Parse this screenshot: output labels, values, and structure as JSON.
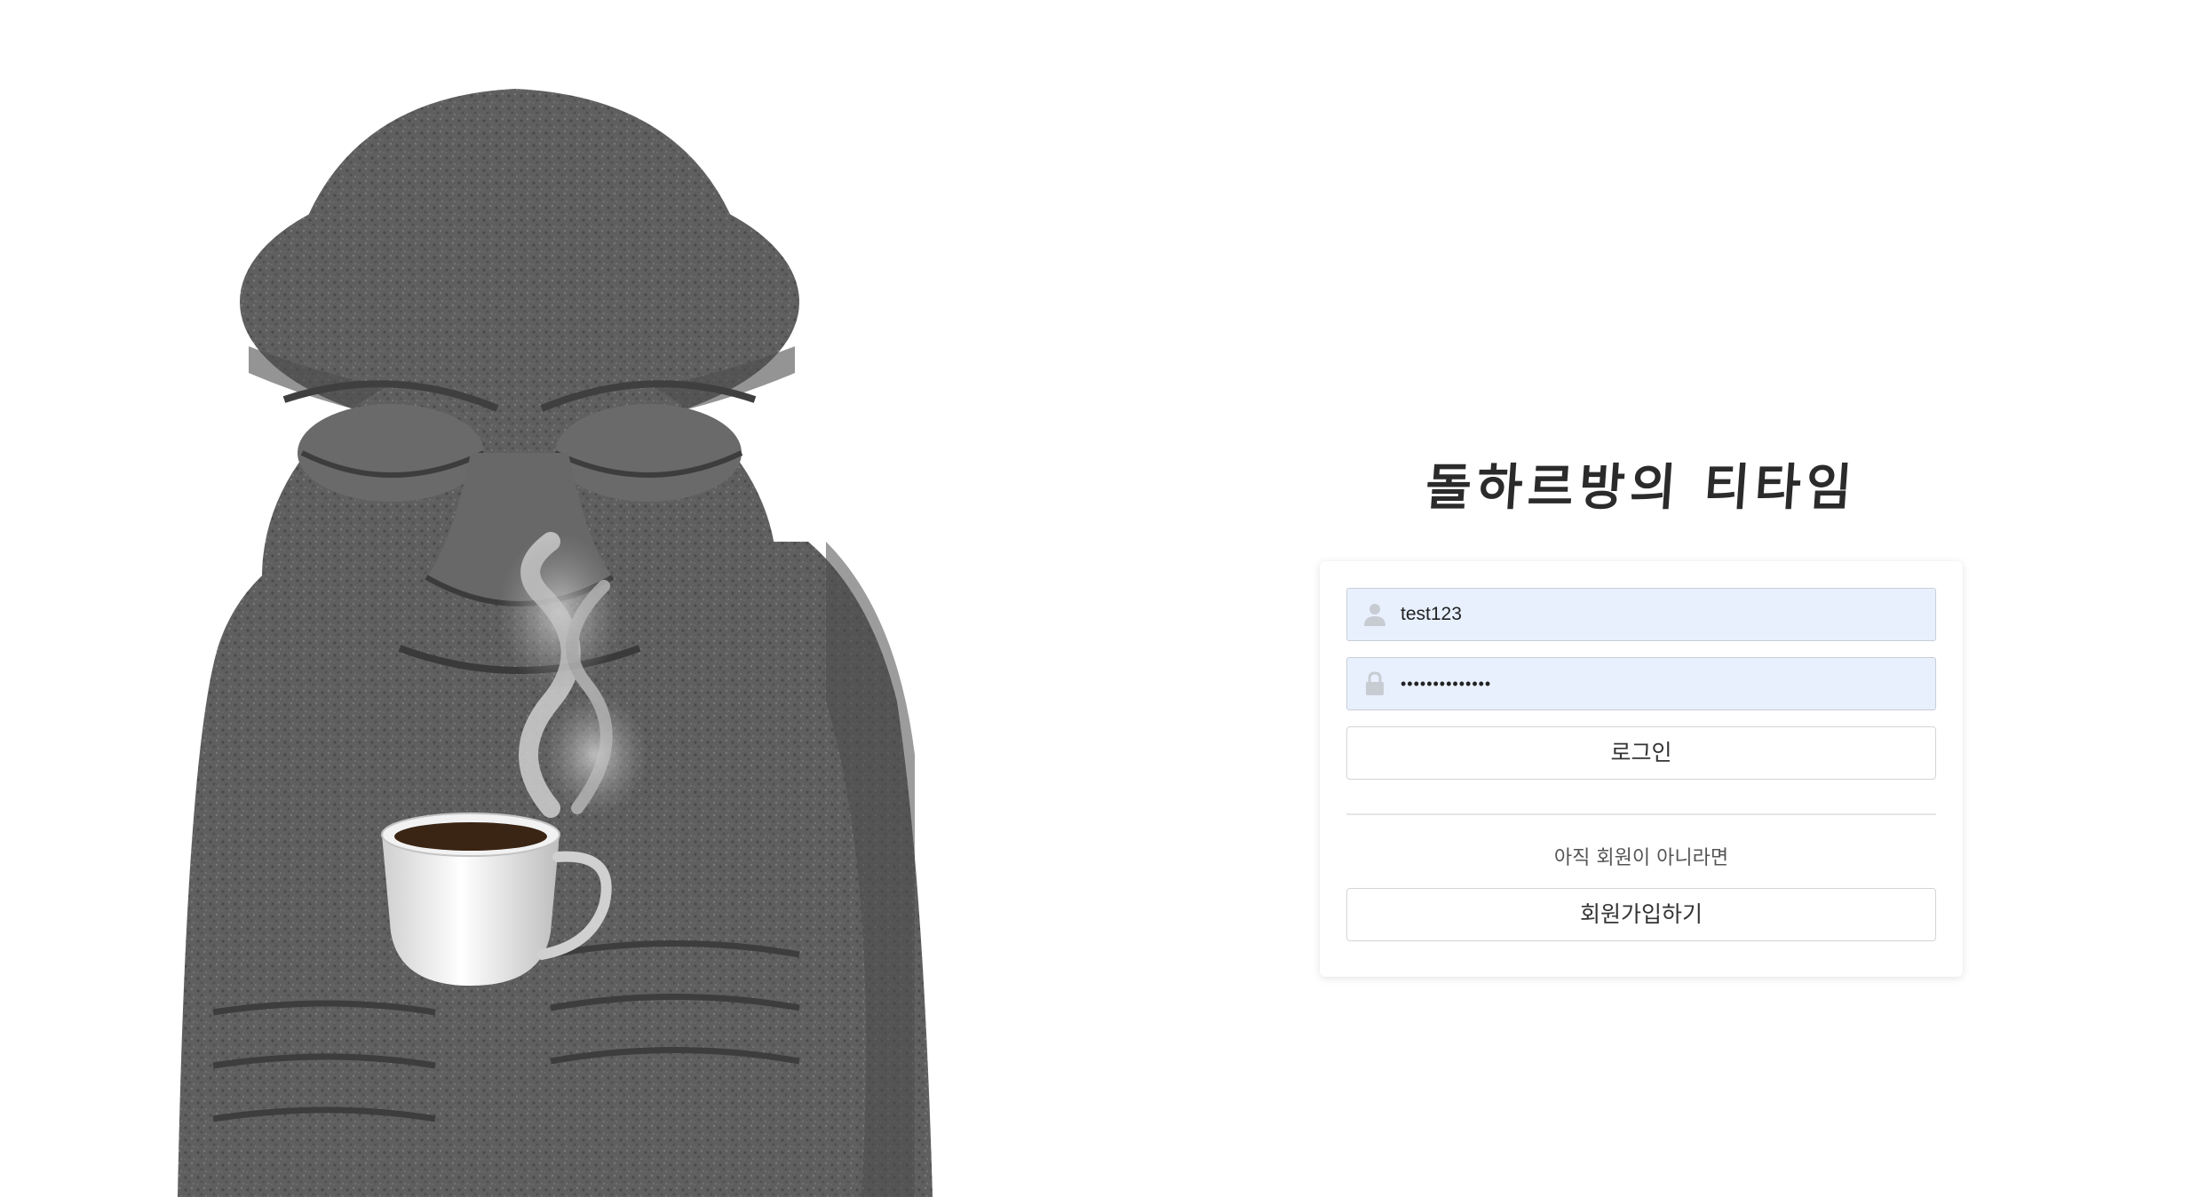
{
  "login": {
    "title": "돌하르방의 티타임",
    "username_value": "test123",
    "password_value": "••••••••••••••",
    "login_button_label": "로그인",
    "signup_note": "아직 회원이 아니라면",
    "signup_button_label": "회원가입하기"
  },
  "icons": {
    "user": "user-icon",
    "lock": "lock-icon"
  },
  "colors": {
    "input_background": "#e8f0fe",
    "title_text": "#2b2b2b",
    "stone": "#5b5b5b"
  }
}
